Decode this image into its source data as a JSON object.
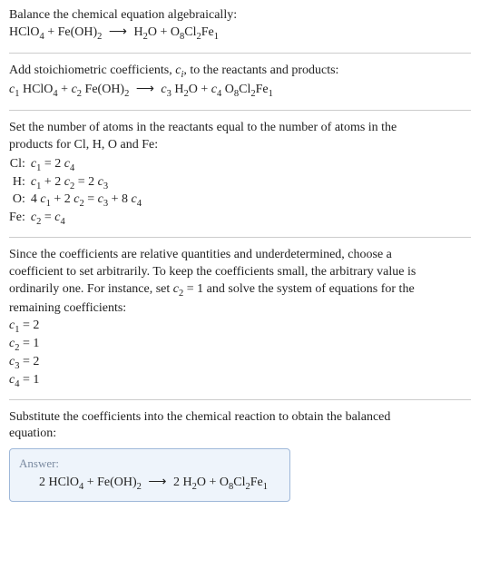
{
  "intro": {
    "line1": "Balance the chemical equation algebraically:",
    "eqn_left_1": "HClO",
    "eqn_left_1_sub": "4",
    "eqn_plus": " + ",
    "eqn_left_2": "Fe(OH)",
    "eqn_left_2_sub": "2",
    "arrow": "⟶",
    "eqn_right_1": "H",
    "eqn_right_1_sub": "2",
    "eqn_right_1b": "O + O",
    "eqn_right_1c_sub": "8",
    "eqn_right_1d": "Cl",
    "eqn_right_1d_sub": "2",
    "eqn_right_1e": "Fe",
    "eqn_right_1e_sub": "1"
  },
  "stoich": {
    "text_a": "Add stoichiometric coefficients, ",
    "ci": "c",
    "ci_sub": "i",
    "text_b": ", to the reactants and products:",
    "c1": "c",
    "c1_sub": "1",
    "sp1": " HClO",
    "sp1_sub": "4",
    "plus": " + ",
    "c2": "c",
    "c2_sub": "2",
    "sp2": " Fe(OH)",
    "sp2_sub": "2",
    "arrow": "⟶",
    "c3": "c",
    "c3_sub": "3",
    "sp3": " H",
    "sp3_sub": "2",
    "sp3b": "O + ",
    "c4": "c",
    "c4_sub": "4",
    "sp4": " O",
    "sp4_sub": "8",
    "sp4b": "Cl",
    "sp4b_sub": "2",
    "sp4c": "Fe",
    "sp4c_sub": "1"
  },
  "atoms": {
    "text1": "Set the number of atoms in the reactants equal to the number of atoms in the",
    "text2": "products for Cl, H, O and Fe:",
    "rows": [
      {
        "lbl": "Cl:",
        "eq_a": "c",
        "eq_a_sub": "1",
        "eq_mid": " = 2 ",
        "eq_b": "c",
        "eq_b_sub": "4",
        "tail": ""
      },
      {
        "lbl": "H:",
        "eq_a": "c",
        "eq_a_sub": "1",
        "eq_mid": " + 2 ",
        "eq_b": "c",
        "eq_b_sub": "2",
        "tail_a": " = 2 ",
        "tail_b": "c",
        "tail_b_sub": "3"
      },
      {
        "lbl": "O:",
        "pre": "4 ",
        "eq_a": "c",
        "eq_a_sub": "1",
        "eq_mid": " + 2 ",
        "eq_b": "c",
        "eq_b_sub": "2",
        "tail_a": " = ",
        "tail_b": "c",
        "tail_b_sub": "3",
        "tail_c": " + 8 ",
        "tail_d": "c",
        "tail_d_sub": "4"
      },
      {
        "lbl": "Fe:",
        "eq_a": "c",
        "eq_a_sub": "2",
        "eq_mid": " = ",
        "eq_b": "c",
        "eq_b_sub": "4",
        "tail": ""
      }
    ]
  },
  "choose": {
    "t1": "Since the coefficients are relative quantities and underdetermined, choose a",
    "t2": "coefficient to set arbitrarily. To keep the coefficients small, the arbitrary value is",
    "t3a": "ordinarily one. For instance, set ",
    "t3b": "c",
    "t3b_sub": "2",
    "t3c": " = 1 and solve the system of equations for the",
    "t4": "remaining coefficients:",
    "res": [
      {
        "c": "c",
        "s": "1",
        "eq": " = 2"
      },
      {
        "c": "c",
        "s": "2",
        "eq": " = 1"
      },
      {
        "c": "c",
        "s": "3",
        "eq": " = 2"
      },
      {
        "c": "c",
        "s": "4",
        "eq": " = 1"
      }
    ]
  },
  "subst": {
    "t1": "Substitute the coefficients into the chemical reaction to obtain the balanced",
    "t2": "equation:"
  },
  "answer": {
    "title": "Answer:",
    "p1": "2 HClO",
    "p1_sub": "4",
    "plus": " + Fe(OH)",
    "p2_sub": "2",
    "arrow": "⟶",
    "p3": "2 H",
    "p3_sub": "2",
    "p3b": "O + O",
    "p3c_sub": "8",
    "p3d": "Cl",
    "p3d_sub": "2",
    "p3e": "Fe",
    "p3e_sub": "1"
  }
}
